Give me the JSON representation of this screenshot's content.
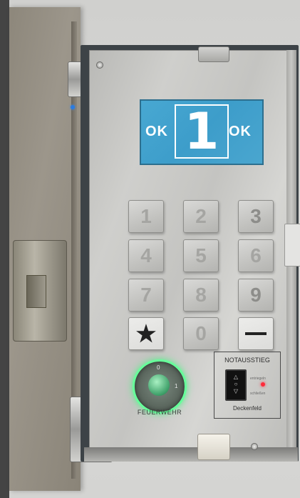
{
  "display": {
    "left_text": "OK",
    "right_text": "OK",
    "digit": "1",
    "background_color": "#3fa1cd"
  },
  "keypad": {
    "keys": [
      "1",
      "2",
      "3",
      "4",
      "5",
      "6",
      "7",
      "8",
      "9",
      "★",
      "0",
      "—"
    ]
  },
  "key_switch": {
    "label": "FEUERWEHR",
    "positions": [
      "0",
      "1"
    ],
    "ring_color": "#66ff9a"
  },
  "emergency_exit": {
    "title": "NOTAUSSTIEG",
    "state_top": "entriegeln",
    "state_bottom": "schließen",
    "footer": "Deckenfeld",
    "led_color": "#ff2a3a",
    "rocker_symbols": [
      "△",
      "○",
      "▽"
    ]
  }
}
